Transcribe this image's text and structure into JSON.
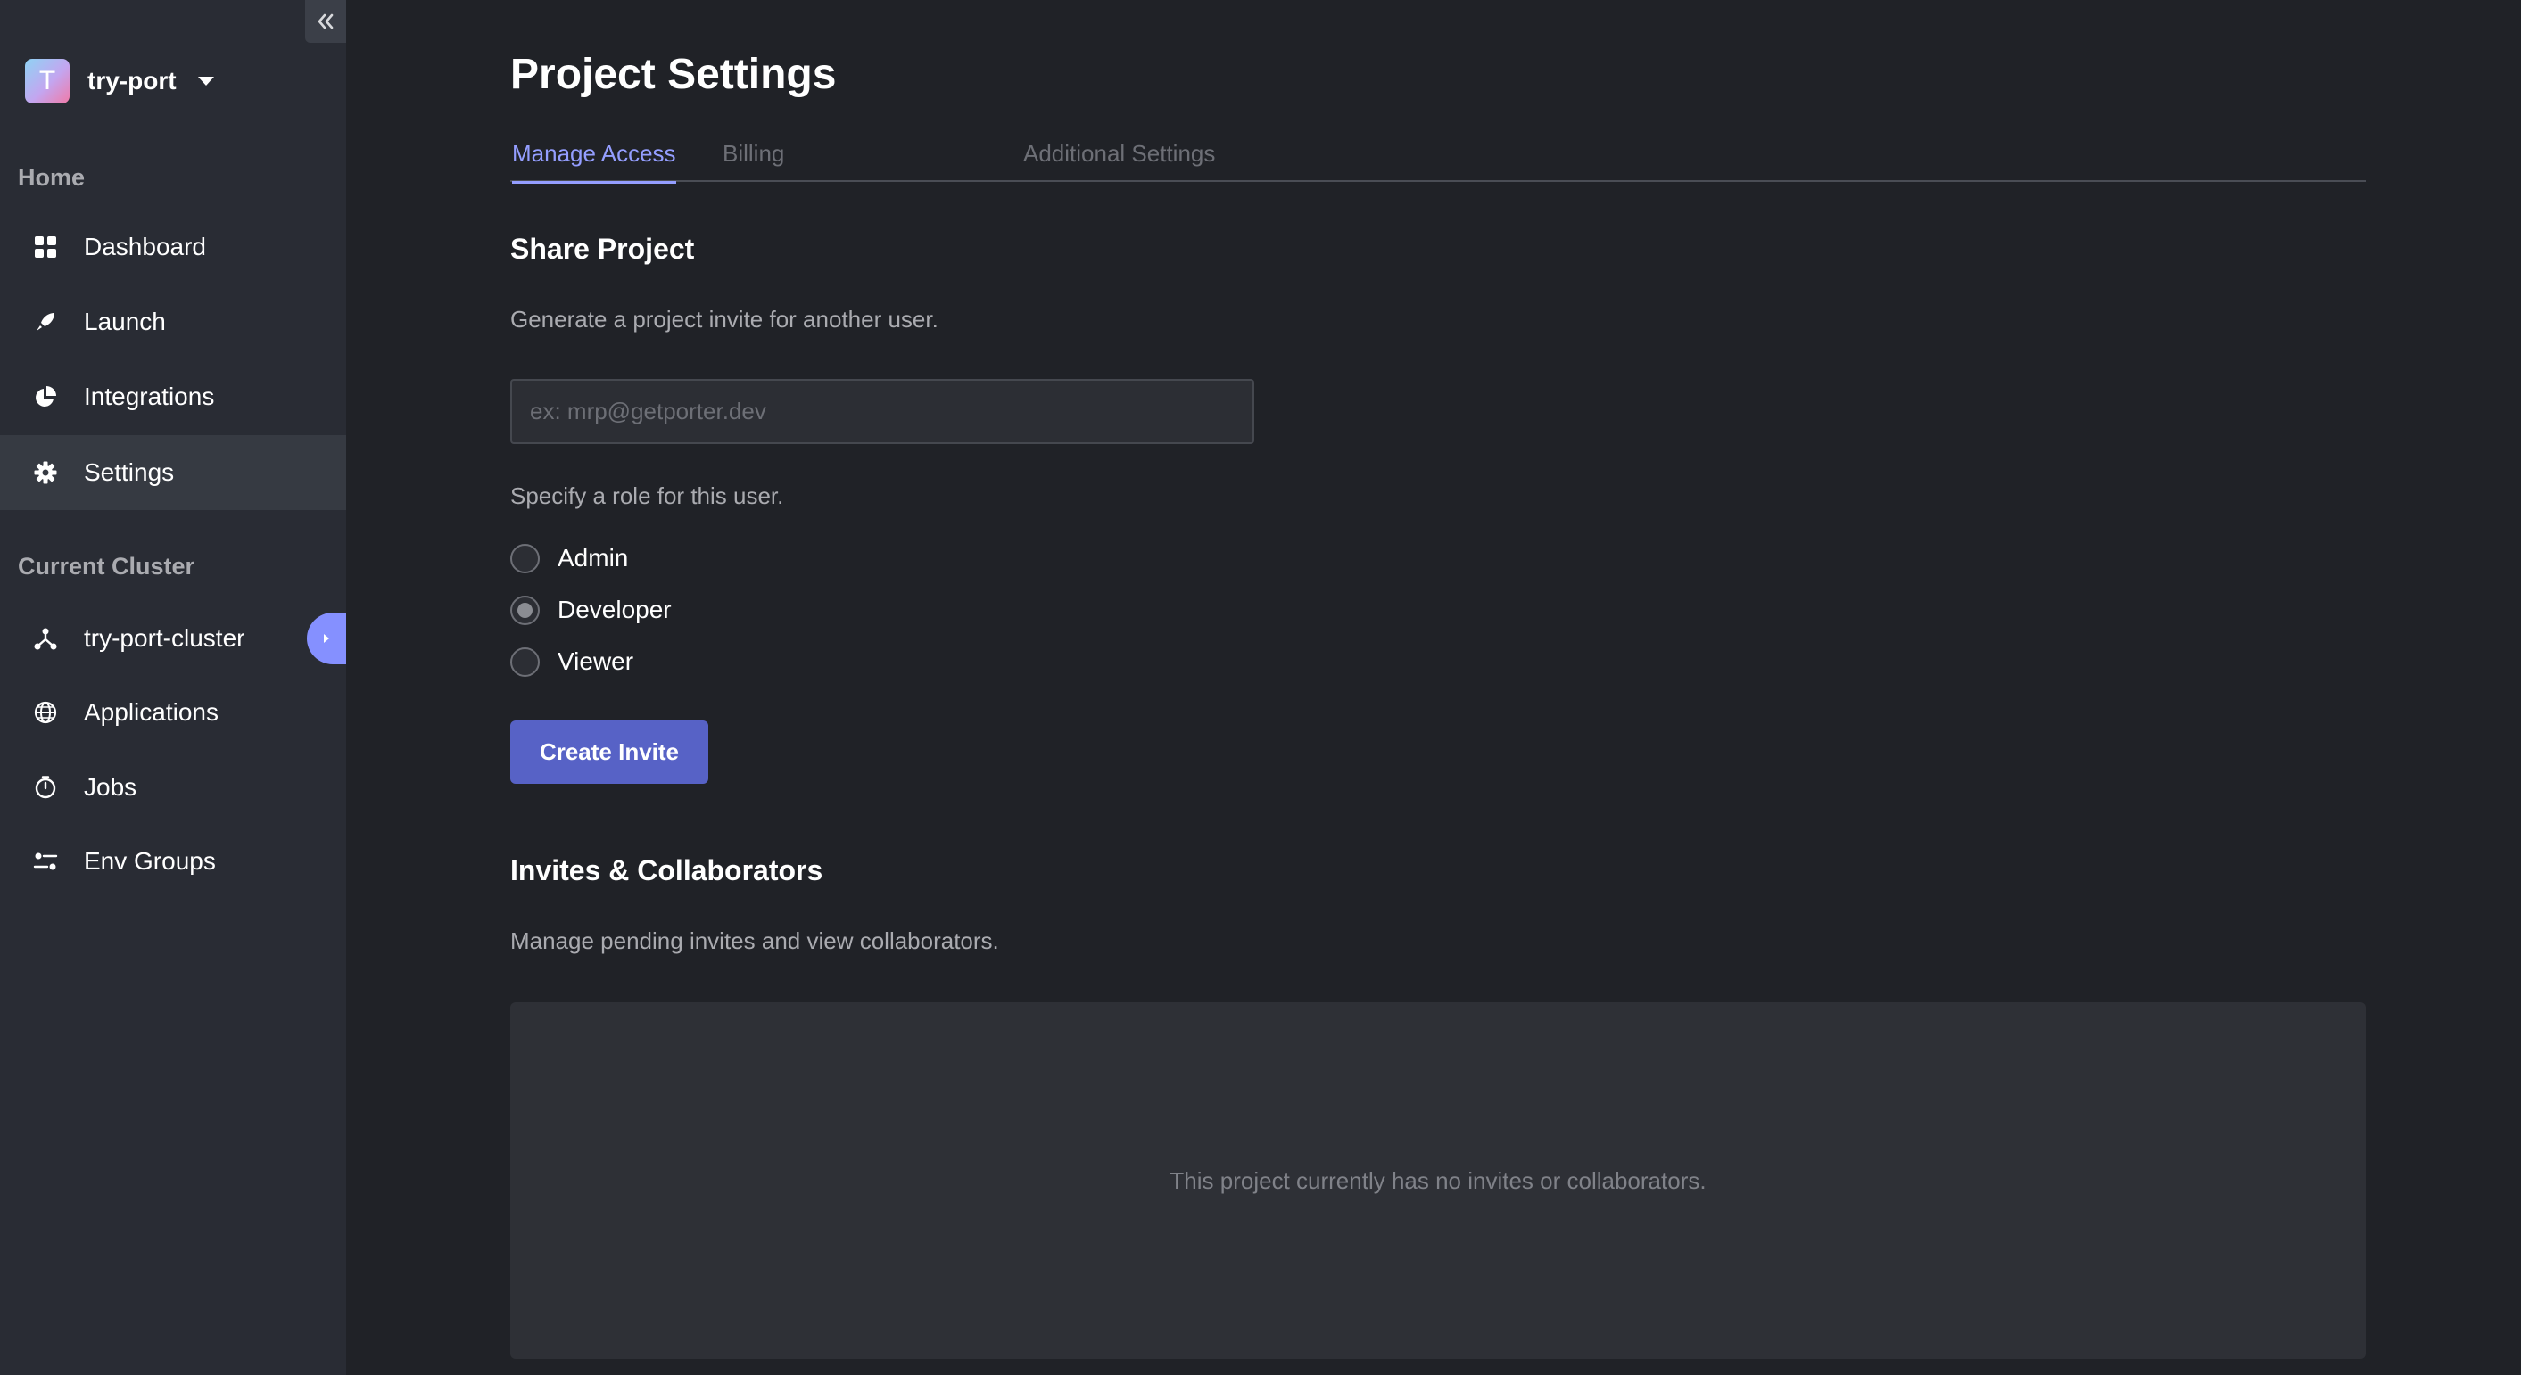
{
  "sidebar": {
    "project": {
      "initial": "T",
      "name": "try-port"
    },
    "home_label": "Home",
    "home_items": [
      {
        "label": "Dashboard",
        "icon": "grid-icon"
      },
      {
        "label": "Launch",
        "icon": "rocket-icon"
      },
      {
        "label": "Integrations",
        "icon": "pie-chart-icon"
      },
      {
        "label": "Settings",
        "icon": "gear-icon",
        "active": true
      }
    ],
    "cluster_label": "Current Cluster",
    "cluster_items": [
      {
        "label": "try-port-cluster",
        "icon": "cluster-icon"
      },
      {
        "label": "Applications",
        "icon": "globe-icon"
      },
      {
        "label": "Jobs",
        "icon": "timer-icon"
      },
      {
        "label": "Env Groups",
        "icon": "sliders-icon"
      }
    ]
  },
  "main": {
    "title": "Project Settings",
    "tabs": [
      {
        "label": "Manage Access",
        "active": true
      },
      {
        "label": "Billing"
      },
      {
        "label": "Additional Settings"
      }
    ],
    "share": {
      "title": "Share Project",
      "description": "Generate a project invite for another user.",
      "email_placeholder": "ex: mrp@getporter.dev",
      "email_value": "",
      "role_prompt": "Specify a role for this user.",
      "roles": [
        {
          "label": "Admin",
          "selected": false
        },
        {
          "label": "Developer",
          "selected": true
        },
        {
          "label": "Viewer",
          "selected": false
        }
      ],
      "create_button": "Create Invite"
    },
    "collaborators": {
      "title": "Invites & Collaborators",
      "description": "Manage pending invites and view collaborators.",
      "empty_message": "This project currently has no invites or collaborators."
    }
  },
  "colors": {
    "background": "#202227",
    "sidebar": "#292c34",
    "accent": "#949eff",
    "button": "#5762c6",
    "toggle": "#8590ff"
  }
}
